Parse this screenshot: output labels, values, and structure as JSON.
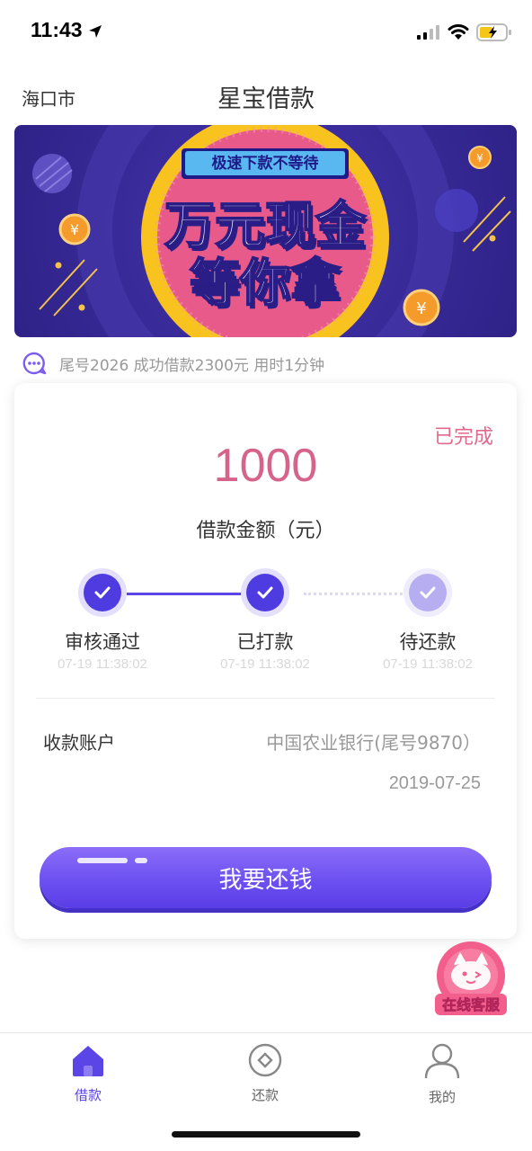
{
  "status_bar": {
    "time": "11:43"
  },
  "header": {
    "city": "海口市",
    "title": "星宝借款"
  },
  "banner": {
    "tag": "极速下款不等待",
    "line1": "万元现金",
    "line2": "等你拿"
  },
  "notice": {
    "text": "尾号2026 成功借款2300元 用时1分钟"
  },
  "loan_card": {
    "status": "已完成",
    "amount": "1000",
    "amount_label": "借款金额（元）",
    "steps": [
      {
        "label": "审核通过",
        "time": "07-19 11:38:02",
        "state": "done"
      },
      {
        "label": "已打款",
        "time": "07-19 11:38:02",
        "state": "done"
      },
      {
        "label": "待还款",
        "time": "07-19 11:38:02",
        "state": "pending"
      }
    ],
    "account_label": "收款账户",
    "account_value": "中国农业银行(尾号9870）",
    "due_date": "2019-07-25",
    "repay_button": "我要还钱"
  },
  "service_fab": {
    "label": "在线客服"
  },
  "tabbar": [
    {
      "label": "借款",
      "icon": "home-icon",
      "active": true
    },
    {
      "label": "还款",
      "icon": "repay-icon",
      "active": false
    },
    {
      "label": "我的",
      "icon": "user-icon",
      "active": false
    }
  ],
  "colors": {
    "accent": "#5b45e6",
    "amount": "#d6648a",
    "status_done": "#e06a8b"
  }
}
